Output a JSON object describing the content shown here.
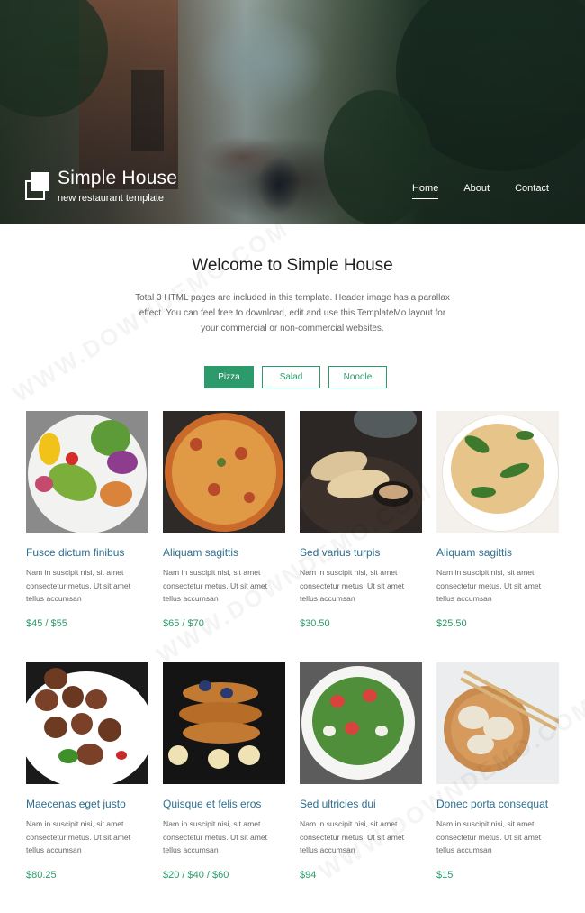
{
  "header": {
    "title": "Simple House",
    "subtitle": "new restaurant template",
    "nav": [
      {
        "label": "Home",
        "active": true
      },
      {
        "label": "About",
        "active": false
      },
      {
        "label": "Contact",
        "active": false
      }
    ]
  },
  "welcome": {
    "title": "Welcome to Simple House",
    "text": "Total 3 HTML pages are included in this template. Header image has a parallax effect. You can feel free to download, edit and use this TemplateMo layout for your commercial or non-commercial websites."
  },
  "tabs": [
    {
      "label": "Pizza",
      "active": true
    },
    {
      "label": "Salad",
      "active": false
    },
    {
      "label": "Noodle",
      "active": false
    }
  ],
  "items": [
    {
      "title": "Fusce dictum finibus",
      "desc": "Nam in suscipit nisi, sit amet consectetur metus. Ut sit amet tellus accumsan",
      "price": "$45 / $55",
      "image": "salad-bowl"
    },
    {
      "title": "Aliquam sagittis",
      "desc": "Nam in suscipit nisi, sit amet consectetur metus. Ut sit amet tellus accumsan",
      "price": "$65 / $70",
      "image": "pizza"
    },
    {
      "title": "Sed varius turpis",
      "desc": "Nam in suscipit nisi, sit amet consectetur metus. Ut sit amet tellus accumsan",
      "price": "$30.50",
      "image": "grilled-dish"
    },
    {
      "title": "Aliquam sagittis",
      "desc": "Nam in suscipit nisi, sit amet consectetur metus. Ut sit amet tellus accumsan",
      "price": "$25.50",
      "image": "pasta"
    },
    {
      "title": "Maecenas eget justo",
      "desc": "Nam in suscipit nisi, sit amet consectetur metus. Ut sit amet tellus accumsan",
      "price": "$80.25",
      "image": "meatballs"
    },
    {
      "title": "Quisque et felis eros",
      "desc": "Nam in suscipit nisi, sit amet consectetur metus. Ut sit amet tellus accumsan",
      "price": "$20 / $40 / $60",
      "image": "pancakes"
    },
    {
      "title": "Sed ultricies dui",
      "desc": "Nam in suscipit nisi, sit amet consectetur metus. Ut sit amet tellus accumsan",
      "price": "$94",
      "image": "green-salad"
    },
    {
      "title": "Donec porta consequat",
      "desc": "Nam in suscipit nisi, sit amet consectetur metus. Ut sit amet tellus accumsan",
      "price": "$15",
      "image": "dumplings"
    }
  ],
  "watermark": "WWW.DOWNDEMO.COM",
  "colors": {
    "accent": "#2c9a6a",
    "title_link": "#2d6f8f"
  }
}
